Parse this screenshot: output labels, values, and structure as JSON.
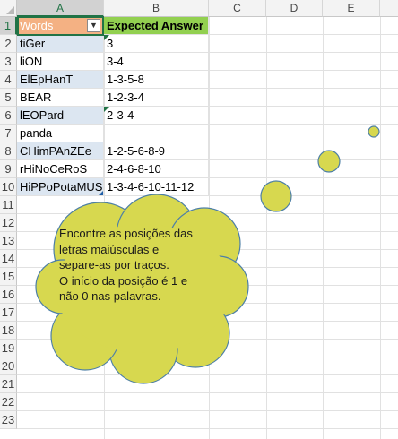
{
  "columns": [
    "A",
    "B",
    "C",
    "D",
    "E"
  ],
  "rows": [
    "1",
    "2",
    "3",
    "4",
    "5",
    "6",
    "7",
    "8",
    "9",
    "10",
    "11",
    "12",
    "13",
    "14",
    "15",
    "16",
    "17",
    "18",
    "19",
    "20",
    "21",
    "22",
    "23"
  ],
  "headers": {
    "a1": "Words",
    "b1": "Expected Answer"
  },
  "filter_icon": "dropdown-arrow-icon",
  "words": [
    "tiGer",
    "liON",
    "ElEpHanT",
    "BEAR",
    "lEOPard",
    "panda",
    "CHimPAnZEe",
    "rHiNoCeRoS",
    "HiPPoPotaMUS"
  ],
  "answers": [
    "3",
    "3-4",
    "1-3-5-8",
    "1-2-3-4",
    "2-3-4",
    "",
    "1-2-5-6-8-9",
    "2-4-6-8-10",
    "1-3-4-6-10-11-12"
  ],
  "callout": {
    "line1": "Encontre as posições das",
    "line2": "letras maiúsculas e",
    "line3": "separe-as por traços.",
    "line4": "O início da posição é 1 e",
    "line5": "não 0 nas palavras."
  },
  "colors": {
    "callout_fill": "#d7d84f",
    "callout_stroke": "#4d7fa6",
    "header_a": "#f4b183",
    "header_b": "#92d050",
    "selection": "#217346"
  }
}
